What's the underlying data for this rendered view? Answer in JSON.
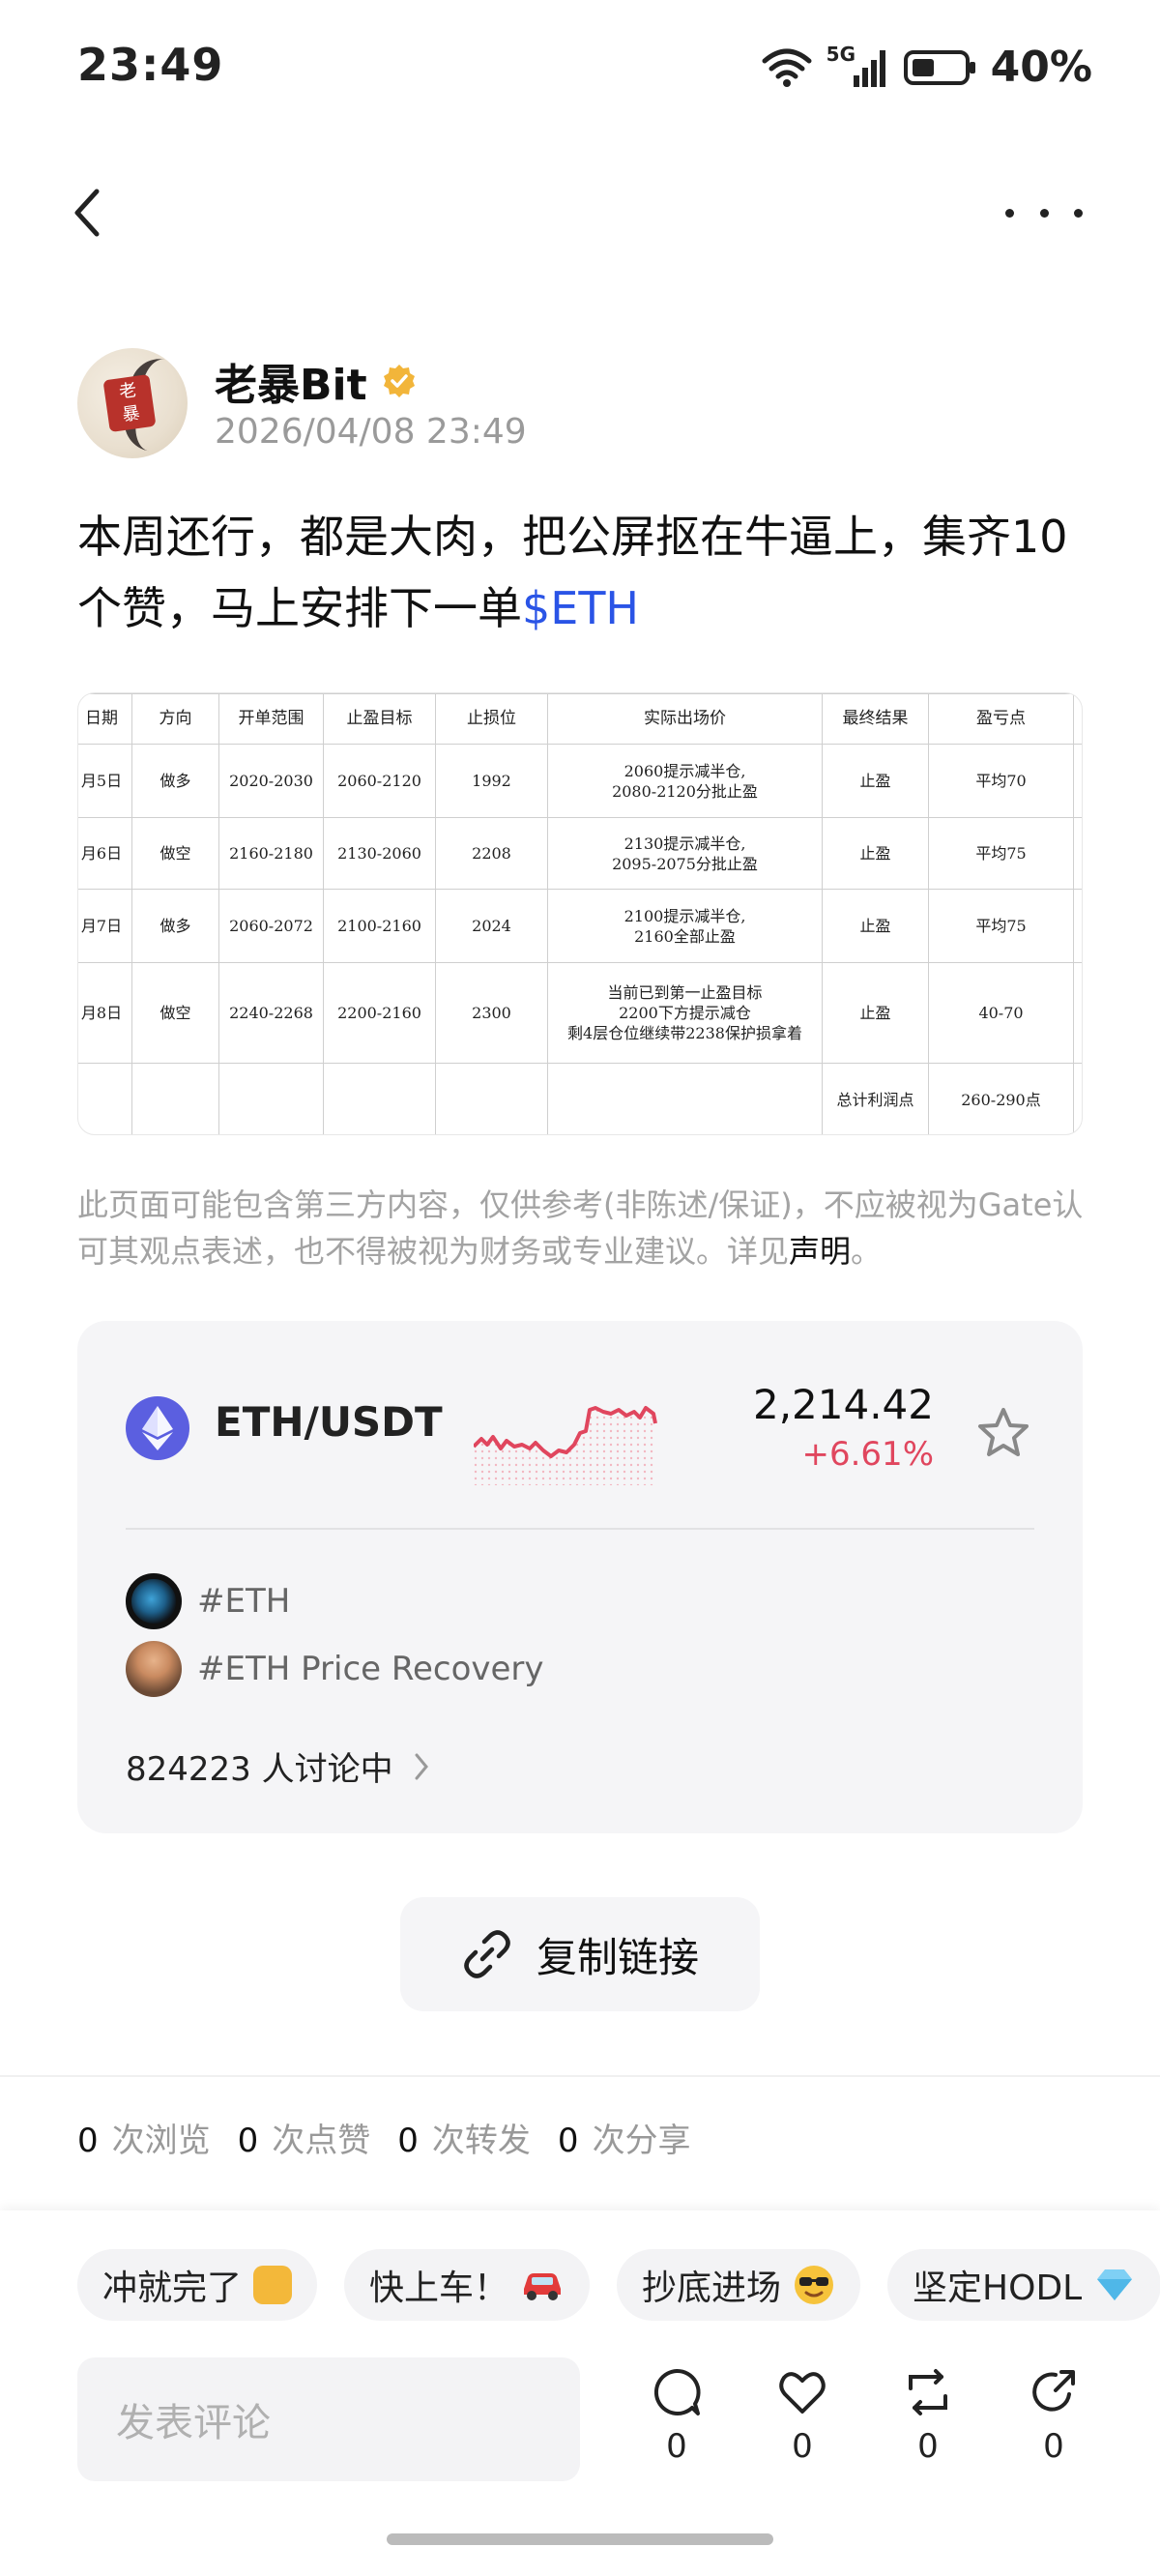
{
  "status_bar": {
    "time": "23:49",
    "network": "5G",
    "battery": "40%"
  },
  "nav": {
    "back": "back",
    "more": "more"
  },
  "author": {
    "name": "老暴Bit",
    "date": "2026/04/08 23:49",
    "avatar_text": "老\n暴"
  },
  "post": {
    "text": "本周还行，都是大肉，把公屏抠在牛逼上，集齐10个赞，马上安排下一单",
    "ticker": "$ETH"
  },
  "trade_table": {
    "headers": [
      "日期",
      "方向",
      "开单范围",
      "止盈目标",
      "止损位",
      "实际出场价",
      "最终结果",
      "盈亏点"
    ],
    "rows": [
      [
        "月5日",
        "做多",
        "2020-2030",
        "2060-2120",
        "1992",
        "2060提示减半仓,\n2080-2120分批止盈",
        "止盈",
        "平均70"
      ],
      [
        "月6日",
        "做空",
        "2160-2180",
        "2130-2060",
        "2208",
        "2130提示减半仓,\n2095-2075分批止盈",
        "止盈",
        "平均75"
      ],
      [
        "月7日",
        "做多",
        "2060-2072",
        "2100-2160",
        "2024",
        "2100提示减半仓,\n2160全部止盈",
        "止盈",
        "平均75"
      ],
      [
        "月8日",
        "做空",
        "2240-2268",
        "2200-2160",
        "2300",
        "当前已到第一止盈目标\n2200下方提示减仓\n剩4层仓位继续带2238保护损拿着",
        "止盈",
        "40-70"
      ],
      [
        "",
        "",
        "",
        "",
        "",
        "",
        "总计利润点",
        "260-290点"
      ]
    ]
  },
  "disclaimer": {
    "text": "此页面可能包含第三方内容，仅供参考(非陈述/保证)，不应被视为Gate认可其观点表述，也不得被视为财务或专业建议。详见",
    "link": "声明",
    "end": "。"
  },
  "market": {
    "pair": "ETH/USDT",
    "price": "2,214.42",
    "change": "+6.61%",
    "change_color": "#e0465e",
    "tags": [
      "#ETH",
      "#ETH Price Recovery"
    ],
    "discussion": "824223 人讨论中"
  },
  "copy_link": "复制链接",
  "stats": [
    {
      "n": "0",
      "label": "次浏览"
    },
    {
      "n": "0",
      "label": "次点赞"
    },
    {
      "n": "0",
      "label": "次转发"
    },
    {
      "n": "0",
      "label": "次分享"
    }
  ],
  "quick_replies": [
    "冲就完了",
    "快上车！",
    "抄底进场",
    "坚定HODL"
  ],
  "comment_placeholder": "发表评论",
  "actions": [
    {
      "icon": "comment-icon",
      "count": "0"
    },
    {
      "icon": "like-icon",
      "count": "0"
    },
    {
      "icon": "repost-icon",
      "count": "0"
    },
    {
      "icon": "share-icon",
      "count": "0"
    }
  ],
  "colors": {
    "accent_blue": "#2a54e6",
    "eth_purple": "#5b5fe0",
    "negative_red": "#e0465e",
    "verified_gold": "#f2b53a"
  }
}
